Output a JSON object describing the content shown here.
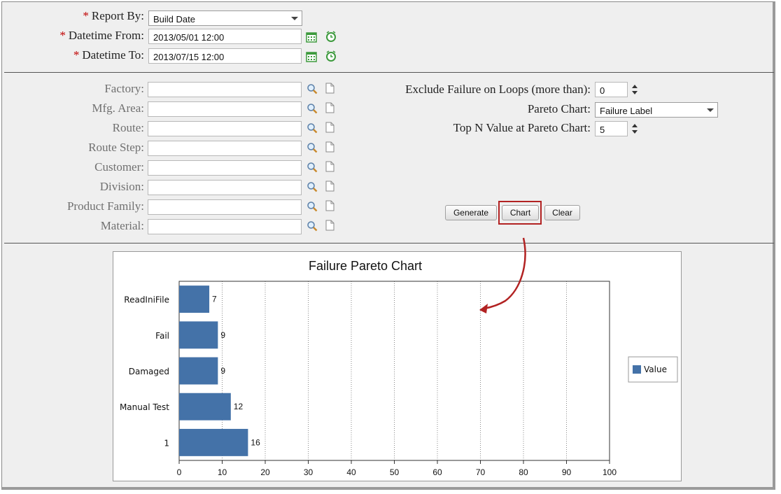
{
  "report": {
    "report_by_label": "Report By:",
    "report_by_value": "Build Date",
    "from_label": "Datetime From:",
    "from_value": "2013/05/01 12:00",
    "to_label": "Datetime To:",
    "to_value": "2013/07/15 12:00",
    "required_mark": "*"
  },
  "filters": [
    {
      "label": "Factory:"
    },
    {
      "label": "Mfg. Area:"
    },
    {
      "label": "Route:"
    },
    {
      "label": "Route Step:"
    },
    {
      "label": "Customer:"
    },
    {
      "label": "Division:"
    },
    {
      "label": "Product Family:"
    },
    {
      "label": "Material:"
    }
  ],
  "options": {
    "exclude_label": "Exclude Failure on Loops (more than):",
    "exclude_value": "0",
    "pareto_label": "Pareto Chart:",
    "pareto_value": "Failure Label",
    "topn_label": "Top N Value at Pareto Chart:",
    "topn_value": "5"
  },
  "buttons": {
    "generate": "Generate",
    "chart": "Chart",
    "clear": "Clear"
  },
  "colors": {
    "bar": "#4472a8",
    "highlight": "#b22222",
    "icon_green": "#3d9a3d"
  },
  "chart_data": {
    "type": "bar",
    "orientation": "horizontal",
    "title": "Failure Pareto Chart",
    "categories": [
      "ReadIniFile",
      "Fail",
      "Damaged",
      "Manual Test",
      "1"
    ],
    "series": [
      {
        "name": "Value",
        "values": [
          7,
          9,
          9,
          12,
          16
        ]
      }
    ],
    "xlim": [
      0,
      100
    ],
    "xticks": [
      0,
      10,
      20,
      30,
      40,
      50,
      60,
      70,
      80,
      90,
      100
    ],
    "grid": "vertical dotted",
    "legend": "right"
  }
}
